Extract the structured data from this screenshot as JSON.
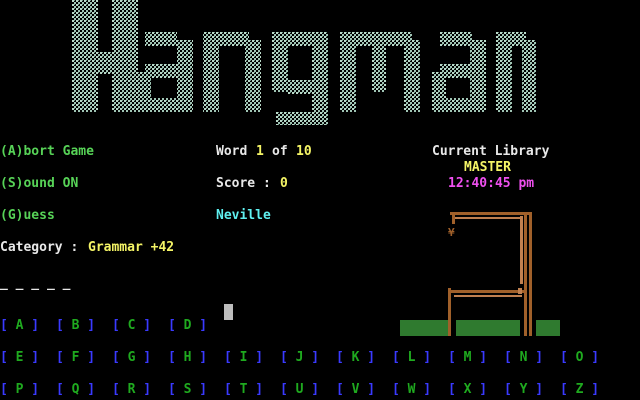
{
  "title": "Hangman",
  "menu": {
    "abort": "(A)bort Game",
    "sound": "(S)ound ON",
    "guess": "(G)uess"
  },
  "status": {
    "word_label": "Word",
    "word_current": "1",
    "word_of": "of",
    "word_total": "10",
    "score_label": "Score :",
    "score_value": "0",
    "player": "Neville"
  },
  "library": {
    "label": "Current Library",
    "name": "MASTER",
    "time": "12:40:45 pm"
  },
  "category": {
    "label": "Category :",
    "value": "Grammar +42"
  },
  "word_blanks": "_ _ _ _ _",
  "letters_row1": [
    "A",
    "B",
    "C",
    "D"
  ],
  "letters_row2": [
    "E",
    "F",
    "G",
    "H",
    "I",
    "J",
    "K",
    "L",
    "M",
    "N",
    "O"
  ],
  "letters_row3": [
    "P",
    "Q",
    "R",
    "S",
    "T",
    "U",
    "V",
    "W",
    "X",
    "Y",
    "Z"
  ],
  "colors": {
    "menu": "#57d357",
    "highlight": "#f4f466",
    "player": "#5ff0f0",
    "time": "#f050f0",
    "bracket": "#3a3aff",
    "letter": "#1faa1f",
    "logo": "#b8d8c8",
    "gallows_wood": "#a0602a",
    "grass": "#2f7a2f"
  }
}
